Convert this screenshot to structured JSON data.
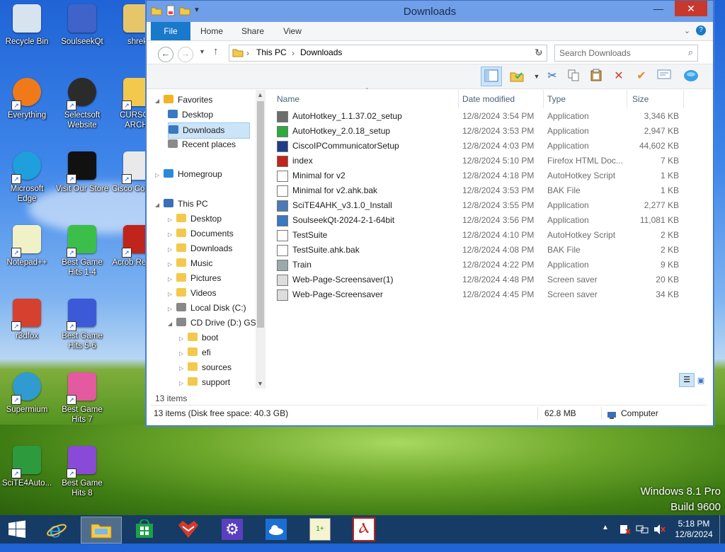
{
  "desktop_icons": [
    {
      "label": "Recycle Bin",
      "icon": "recycle-bin-icon"
    },
    {
      "label": "SoulseekQt",
      "icon": "soulseek-bird-icon"
    },
    {
      "label": "shrek",
      "icon": "folder-image-icon"
    },
    {
      "label": "Everything",
      "icon": "everything-magnifier-icon"
    },
    {
      "label": "Selectsoft Website",
      "icon": "selectsoft-icon"
    },
    {
      "label": "CURSOR ARCHI",
      "icon": "folder-icon"
    },
    {
      "label": "Microsoft Edge",
      "icon": "edge-icon"
    },
    {
      "label": "Visit Our Store",
      "icon": "store-icon"
    },
    {
      "label": "Cisco Commu",
      "icon": "cisco-icon"
    },
    {
      "label": "Notepad++",
      "icon": "notepadpp-icon"
    },
    {
      "label": "Best Game Hits 1-4",
      "icon": "dice-green-icon"
    },
    {
      "label": "Acrob Reader",
      "icon": "acrobat-icon"
    },
    {
      "label": "r3dfox",
      "icon": "r3dfox-icon"
    },
    {
      "label": "Best Game Hits 5-6",
      "icon": "dice-blue-icon"
    },
    {
      "label": "Supermium",
      "icon": "supermium-icon"
    },
    {
      "label": "Best Game Hits 7",
      "icon": "dice-pink-icon"
    },
    {
      "label": "SciTE4Auto...",
      "icon": "scite-icon"
    },
    {
      "label": "Best Game Hits 8",
      "icon": "dice-purple-icon"
    }
  ],
  "window": {
    "title": "Downloads",
    "ribbon_tabs": [
      "File",
      "Home",
      "Share",
      "View"
    ],
    "address": {
      "root": "This PC",
      "current": "Downloads"
    },
    "search_placeholder": "Search Downloads",
    "nav": {
      "favorites_label": "Favorites",
      "favorites": [
        "Desktop",
        "Downloads",
        "Recent places"
      ],
      "homegroup": "Homegroup",
      "this_pc": "This PC",
      "pc_items": [
        "Desktop",
        "Documents",
        "Downloads",
        "Music",
        "Pictures",
        "Videos",
        "Local Disk (C:)",
        "CD Drive (D:) GSP"
      ],
      "cd_items": [
        "boot",
        "efi",
        "sources",
        "support"
      ],
      "items_count": "13 items"
    },
    "columns": {
      "name": "Name",
      "date": "Date modified",
      "type": "Type",
      "size": "Size"
    },
    "files": [
      {
        "name": "AutoHotkey_1.1.37.02_setup",
        "date": "12/8/2024 3:54 PM",
        "type": "Application",
        "size": "3,346 KB",
        "icon": "ahk-setup-icon"
      },
      {
        "name": "AutoHotkey_2.0.18_setup",
        "date": "12/8/2024 3:53 PM",
        "type": "Application",
        "size": "2,947 KB",
        "icon": "ahk-green-icon"
      },
      {
        "name": "CiscoIPCommunicatorSetup",
        "date": "12/8/2024 4:03 PM",
        "type": "Application",
        "size": "44,602 KB",
        "icon": "cisco-setup-icon"
      },
      {
        "name": "index",
        "date": "12/8/2024 5:10 PM",
        "type": "Firefox HTML Doc...",
        "size": "7 KB",
        "icon": "html-doc-icon"
      },
      {
        "name": "Minimal for v2",
        "date": "12/8/2024 4:18 PM",
        "type": "AutoHotkey Script",
        "size": "1 KB",
        "icon": "ahk-script-icon"
      },
      {
        "name": "Minimal for v2.ahk.bak",
        "date": "12/8/2024 3:53 PM",
        "type": "BAK File",
        "size": "1 KB",
        "icon": "blank-file-icon"
      },
      {
        "name": "SciTE4AHK_v3.1.0_Install",
        "date": "12/8/2024 3:55 PM",
        "type": "Application",
        "size": "2,277 KB",
        "icon": "scite-setup-icon"
      },
      {
        "name": "SoulseekQt-2024-2-1-64bit",
        "date": "12/8/2024 3:56 PM",
        "type": "Application",
        "size": "11,081 KB",
        "icon": "installer-icon"
      },
      {
        "name": "TestSuite",
        "date": "12/8/2024 4:10 PM",
        "type": "AutoHotkey Script",
        "size": "2 KB",
        "icon": "ahk-script-icon"
      },
      {
        "name": "TestSuite.ahk.bak",
        "date": "12/8/2024 4:08 PM",
        "type": "BAK File",
        "size": "2 KB",
        "icon": "blank-file-icon"
      },
      {
        "name": "Train",
        "date": "12/8/2024 4:22 PM",
        "type": "Application",
        "size": "9 KB",
        "icon": "app-icon"
      },
      {
        "name": "Web-Page-Screensaver(1)",
        "date": "12/8/2024 4:48 PM",
        "type": "Screen saver",
        "size": "20 KB",
        "icon": "screensaver-icon"
      },
      {
        "name": "Web-Page-Screensaver",
        "date": "12/8/2024 4:45 PM",
        "type": "Screen saver",
        "size": "34 KB",
        "icon": "screensaver-icon"
      }
    ],
    "status": {
      "left": "13 items (Disk free space: 40.3 GB)",
      "size": "62.8 MB",
      "location": "Computer"
    }
  },
  "taskbar": {
    "apps": [
      "start",
      "ie",
      "explorer",
      "store",
      "r3dfox",
      "settings",
      "onedrive",
      "notepadpp",
      "acrobat"
    ],
    "time": "5:18 PM",
    "date": "12/8/2024"
  },
  "brand": {
    "line1": "Windows 8.1 Pro",
    "line2": "Build 9600"
  }
}
